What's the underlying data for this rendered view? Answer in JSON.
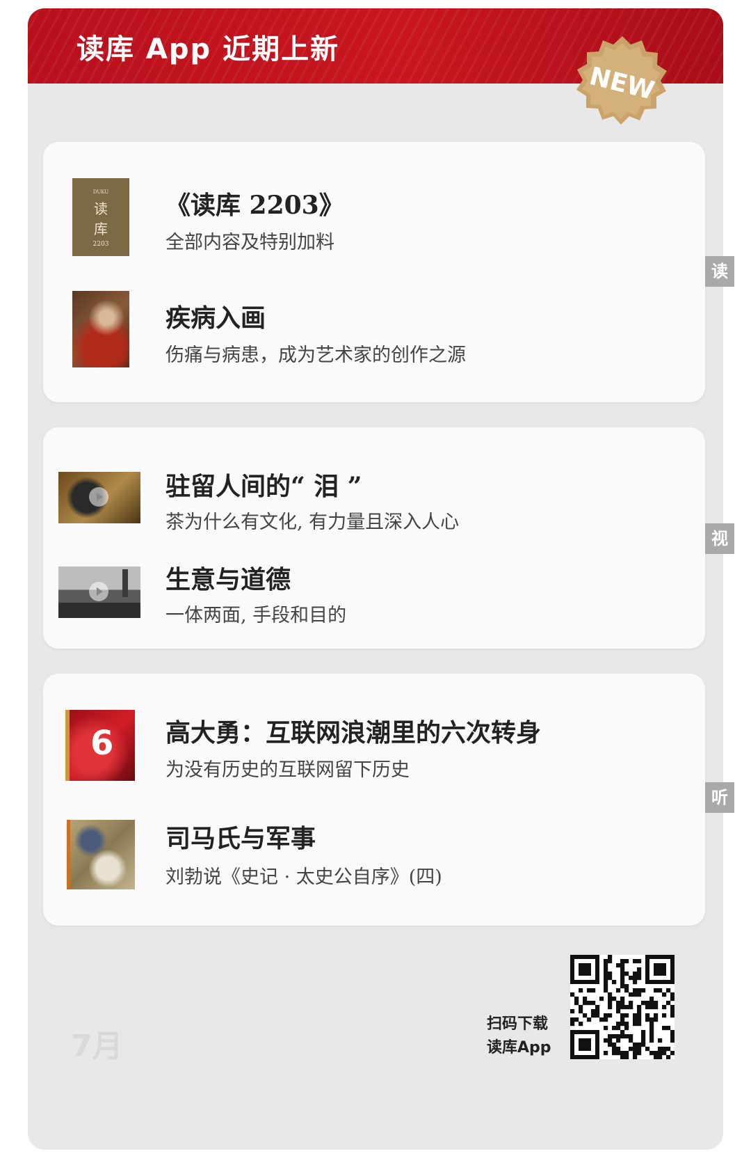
{
  "banner": {
    "title": "读库 App 近期上新",
    "badge": "NEW"
  },
  "sections": [
    {
      "tag": "读",
      "items": [
        {
          "title": "《读库 2203》",
          "subtitle": "全部内容及特别加料",
          "thumb": "book-cover-duku-2203",
          "cover_text": {
            "brand": "DUKU",
            "line1": "读",
            "line2": "库",
            "issue": "2203"
          }
        },
        {
          "title": "疾病入画",
          "subtitle": "伤痛与病患，成为艺术家的创作之源",
          "thumb": "painting-thumbnail"
        }
      ]
    },
    {
      "tag": "视",
      "items": [
        {
          "title": "驻留人间的“ 泪 ”",
          "subtitle": "茶为什么有文化, 有力量且深入人心",
          "thumb": "video-thumbnail-tea"
        },
        {
          "title": "生意与道德",
          "subtitle": "一体两面, 手段和目的",
          "thumb": "video-thumbnail-london"
        }
      ]
    },
    {
      "tag": "听",
      "items": [
        {
          "title": "高大勇：互联网浪潮里的六次转身",
          "subtitle": "为没有历史的互联网留下历史",
          "thumb": "audio-cover-six",
          "cover_text": "6"
        },
        {
          "title": "司马氏与军事",
          "subtitle": "刘勃说《史记 · 太史公自序》(四)",
          "thumb": "audio-cover-painting"
        }
      ]
    }
  ],
  "footer": {
    "month": "7月",
    "scan_line1": "扫码下载",
    "scan_line2": "读库App",
    "qr_icon": "qr-code-icon"
  },
  "colors": {
    "banner_red": "#c8161f",
    "badge_gold": "#c9a36a",
    "tag_gray": "#a9a9a9"
  }
}
